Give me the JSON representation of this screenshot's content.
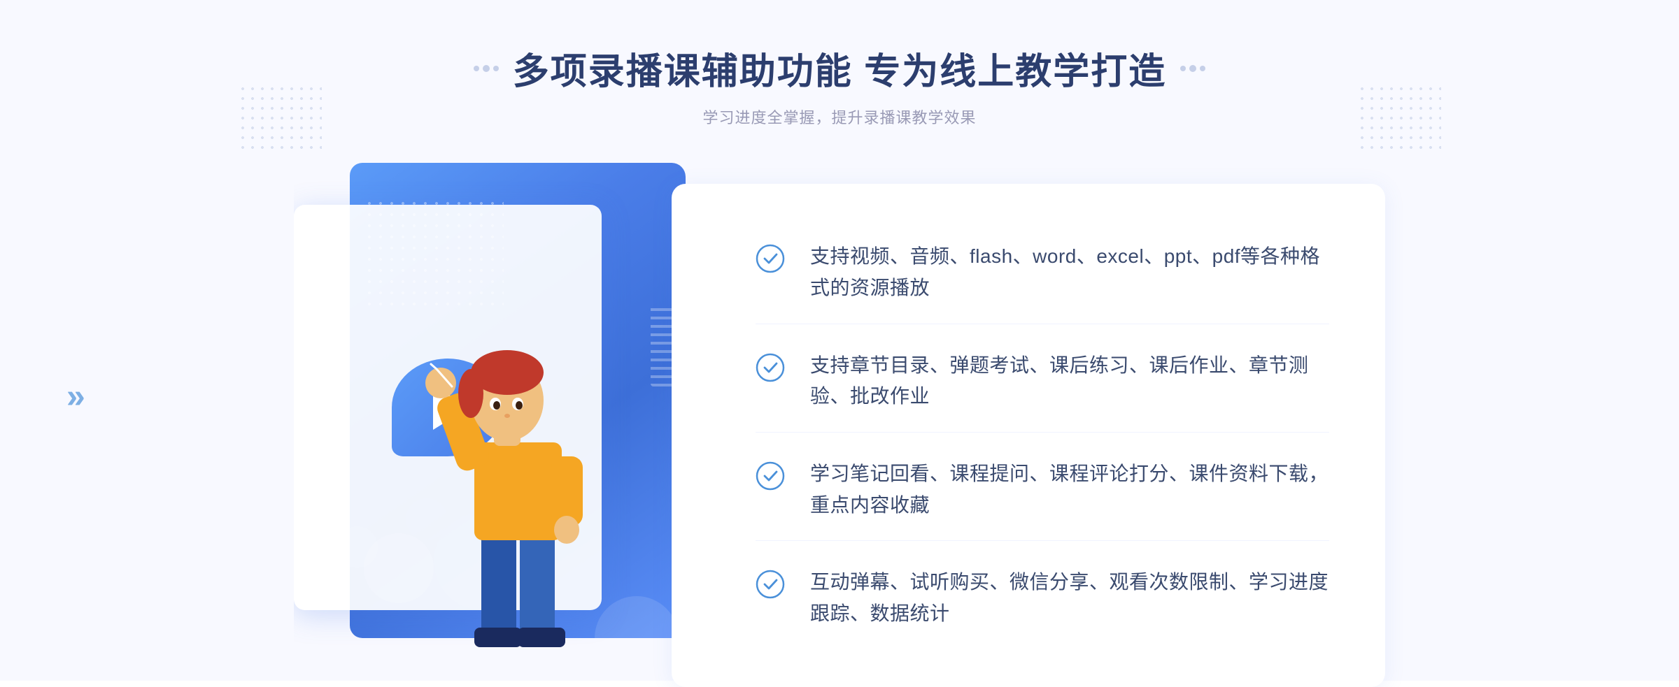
{
  "header": {
    "title": "多项录播课辅助功能 专为线上教学打造",
    "subtitle": "学习进度全掌握，提升录播课教学效果",
    "dots_left_label": "header-dots-left",
    "dots_right_label": "header-dots-right"
  },
  "features": [
    {
      "id": 1,
      "text": "支持视频、音频、flash、word、excel、ppt、pdf等各种格式的资源播放"
    },
    {
      "id": 2,
      "text": "支持章节目录、弹题考试、课后练习、课后作业、章节测验、批改作业"
    },
    {
      "id": 3,
      "text": "学习笔记回看、课程提问、课程评论打分、课件资料下载，重点内容收藏"
    },
    {
      "id": 4,
      "text": "互动弹幕、试听购买、微信分享、观看次数限制、学习进度跟踪、数据统计"
    }
  ],
  "colors": {
    "primary_blue": "#4a7de8",
    "light_blue": "#5b9bf8",
    "text_dark": "#2c3e6e",
    "text_medium": "#3a4a6e",
    "text_light": "#999ab5",
    "bg": "#f8f9ff",
    "check_color": "#4a90d9"
  },
  "chevron": "»",
  "play_icon": "▶"
}
